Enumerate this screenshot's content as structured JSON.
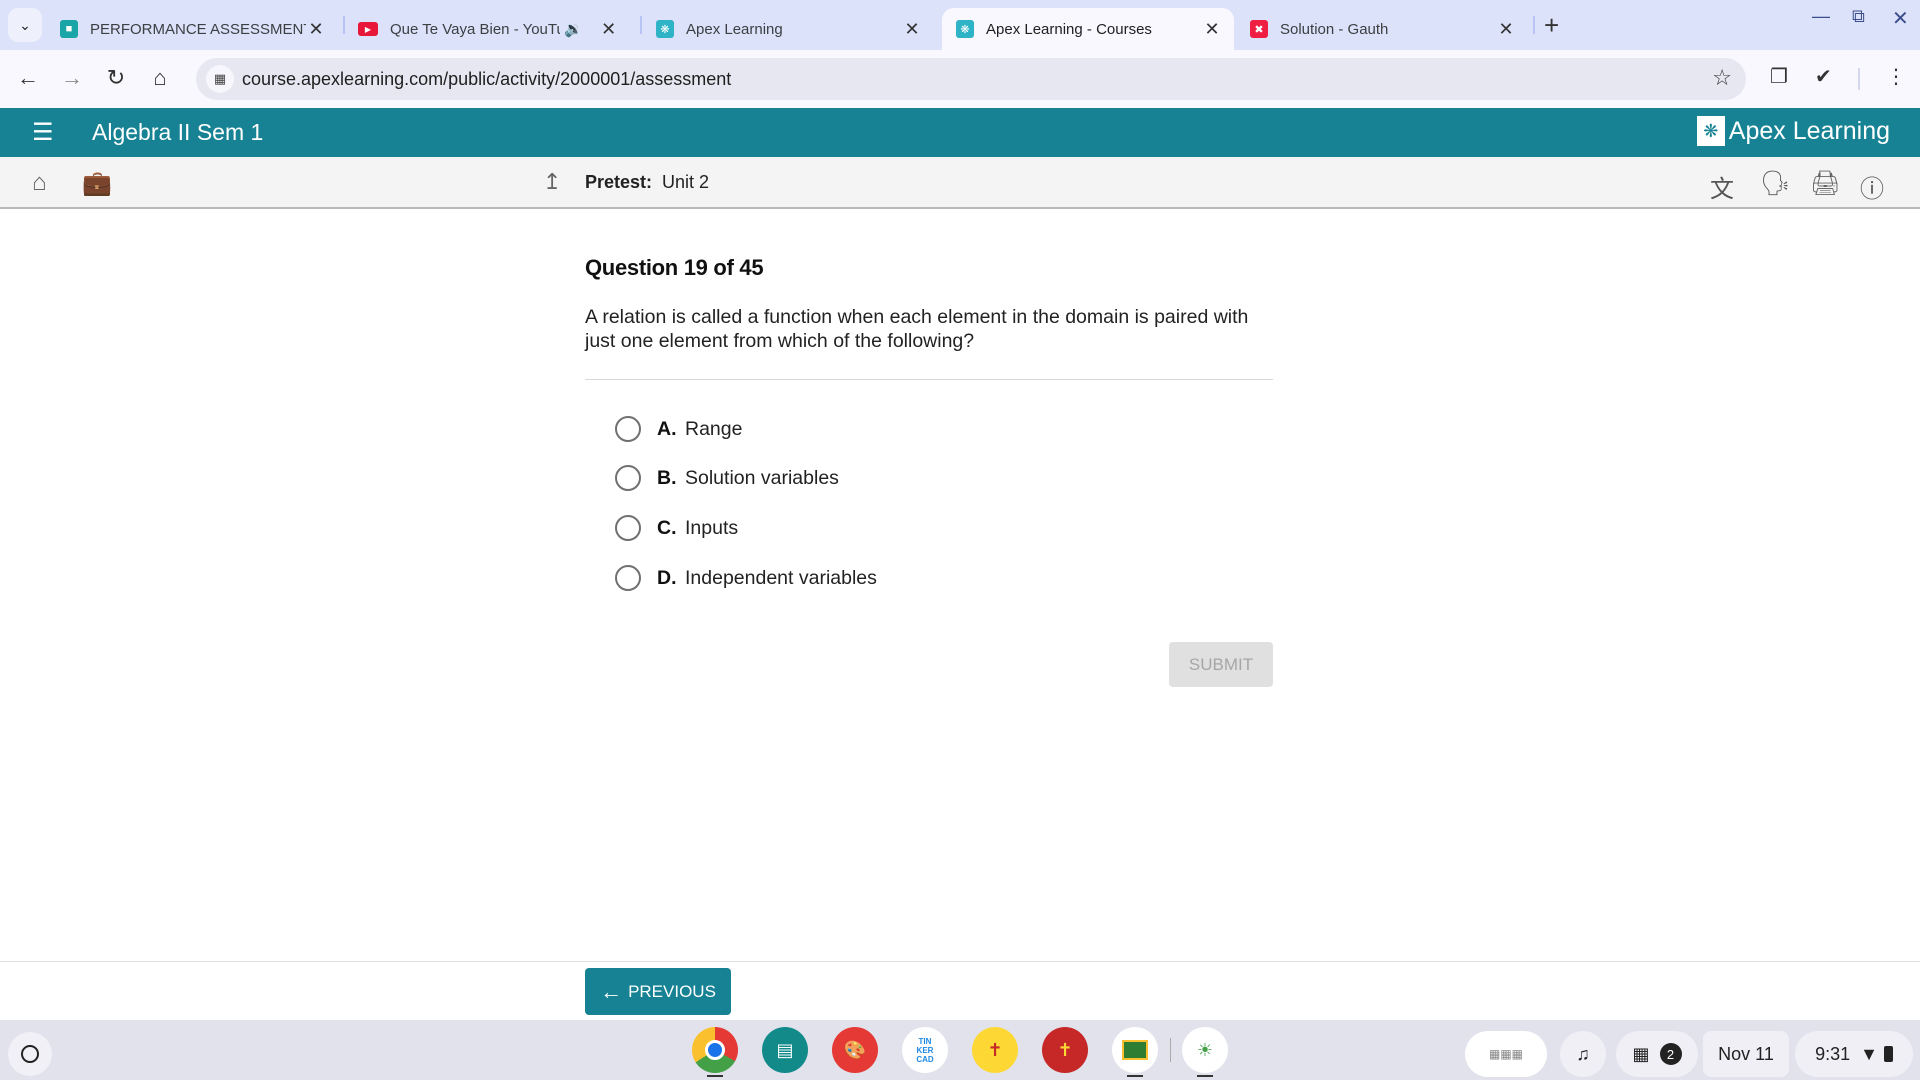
{
  "browser": {
    "tabs": [
      {
        "title": "PERFORMANCE ASSESSMENT",
        "favicon": "classroom-icon",
        "active": false
      },
      {
        "title": "Que Te Vaya Bien - YouTube",
        "favicon": "youtube-icon",
        "active": false,
        "audio": true
      },
      {
        "title": "Apex Learning",
        "favicon": "apex-icon",
        "active": false
      },
      {
        "title": "Apex Learning - Courses",
        "favicon": "apex-icon",
        "active": true
      },
      {
        "title": "Solution - Gauth",
        "favicon": "gauth-icon",
        "active": false
      }
    ],
    "url": "course.apexlearning.com/public/activity/2000001/assessment"
  },
  "app": {
    "course_title": "Algebra II Sem 1",
    "logo_text": "Apex Learning",
    "brand_color": "#168294",
    "breadcrumb_label": "Pretest:",
    "breadcrumb_value": "Unit 2"
  },
  "question": {
    "number_label": "Question 19 of 45",
    "text": "A relation is called a function when each element in the domain is paired with just one element from which of the following?",
    "options": [
      {
        "letter": "A.",
        "text": "Range"
      },
      {
        "letter": "B.",
        "text": "Solution variables"
      },
      {
        "letter": "C.",
        "text": "Inputs"
      },
      {
        "letter": "D.",
        "text": "Independent variables"
      }
    ],
    "selected": null,
    "submit_label": "SUBMIT"
  },
  "footer": {
    "previous_label": "PREVIOUS"
  },
  "shelf": {
    "apps": [
      "chrome",
      "screencast",
      "canvas",
      "tinkercad",
      "app-yellow",
      "app-red",
      "google-classroom",
      "gauth"
    ],
    "tinkercad_text": "TIN KER CAD",
    "notification_count": "2",
    "date": "Nov 11",
    "time": "9:31"
  }
}
